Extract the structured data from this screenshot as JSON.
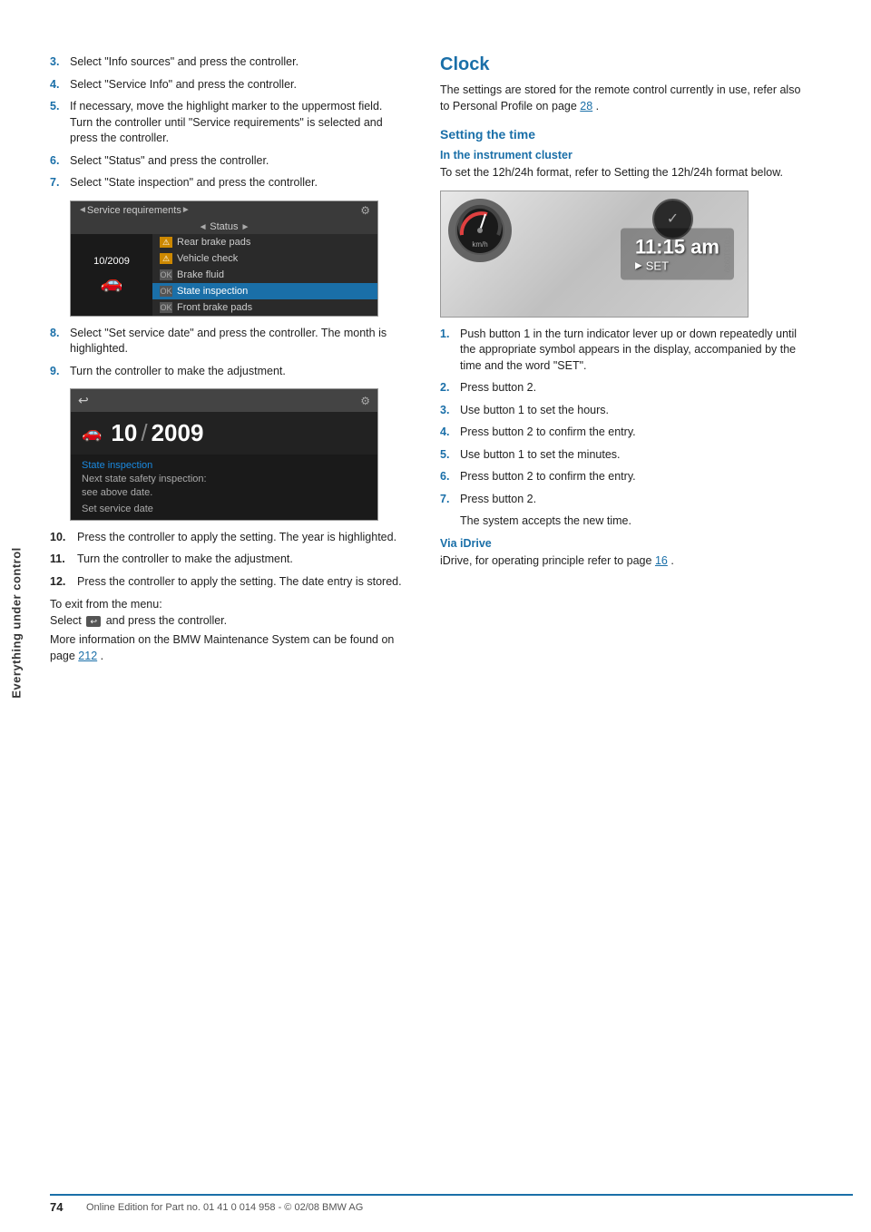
{
  "sidebar": {
    "label": "Everything under control"
  },
  "left_column": {
    "steps": [
      {
        "num": "3.",
        "text": "Select \"Info sources\" and press the controller."
      },
      {
        "num": "4.",
        "text": "Select \"Service Info\" and press the controller."
      },
      {
        "num": "5.",
        "text": "If necessary, move the highlight marker to the uppermost field. Turn the controller until \"Service requirements\" is selected and press the controller."
      },
      {
        "num": "6.",
        "text": "Select \"Status\" and press the controller."
      },
      {
        "num": "7.",
        "text": "Select \"State inspection\" and press the controller."
      }
    ],
    "screenshot1": {
      "header": "Service requirements",
      "subheader": "Status",
      "date": "10/2009",
      "items": [
        {
          "icon": "warning",
          "label": "Rear brake pads",
          "selected": false
        },
        {
          "icon": "warning",
          "label": "Vehicle check",
          "selected": false
        },
        {
          "icon": "ok",
          "label": "Brake fluid",
          "selected": false
        },
        {
          "icon": "ok",
          "label": "State inspection",
          "selected": true
        },
        {
          "icon": "ok",
          "label": "Front brake pads",
          "selected": false
        }
      ]
    },
    "steps2": [
      {
        "num": "8.",
        "text": "Select \"Set service date\" and press the controller. The month is highlighted."
      },
      {
        "num": "9.",
        "text": "Turn the controller to make the adjustment."
      }
    ],
    "screenshot2": {
      "month": "10",
      "separator": "/",
      "year": "2009",
      "title": "State inspection",
      "desc1": "Next state safety inspection:",
      "desc2": "see above date.",
      "link": "Set service date"
    },
    "steps3": [
      {
        "num": "10.",
        "text": "Press the controller to apply the setting. The year is highlighted."
      },
      {
        "num": "11.",
        "text": "Turn the controller to make the adjustment."
      },
      {
        "num": "12.",
        "text": "Press the controller to apply the setting. The date entry is stored."
      }
    ],
    "exit_text1": "To exit from the menu:",
    "exit_text2": "Select",
    "exit_text3": "and press the controller.",
    "more_info": "More information on the BMW Maintenance System can be found on page",
    "more_info_page": "212",
    "more_info_end": "."
  },
  "right_column": {
    "clock_title": "Clock",
    "clock_intro": "The settings are stored for the remote control currently in use, refer also to Personal Profile on page",
    "clock_intro_page": "28",
    "clock_intro_end": ".",
    "setting_time_title": "Setting the time",
    "in_cluster_subtitle": "In the instrument cluster",
    "in_cluster_text": "To set the 12h/24h format, refer to Setting the 12h/24h format below.",
    "clock_display": "11:15 am",
    "clock_set_label": "SET",
    "steps": [
      {
        "num": "1.",
        "text": "Push button 1 in the turn indicator lever up or down repeatedly until the appropriate symbol appears in the display, accompanied by the time and the word \"SET\"."
      },
      {
        "num": "2.",
        "text": "Press button 2."
      },
      {
        "num": "3.",
        "text": "Use button 1 to set the hours."
      },
      {
        "num": "4.",
        "text": "Press button 2 to confirm the entry."
      },
      {
        "num": "5.",
        "text": "Use button 1 to set the minutes."
      },
      {
        "num": "6.",
        "text": "Press button 2 to confirm the entry."
      },
      {
        "num": "7.",
        "text": "Press button 2."
      }
    ],
    "step7_extra": "The system accepts the new time.",
    "via_idrive_subtitle": "Via iDrive",
    "via_idrive_text": "iDrive, for operating principle refer to page",
    "via_idrive_page": "16",
    "via_idrive_end": "."
  },
  "footer": {
    "page_num": "74",
    "footer_text": "Online Edition for Part no. 01 41 0 014 958 - © 02/08 BMW AG"
  }
}
